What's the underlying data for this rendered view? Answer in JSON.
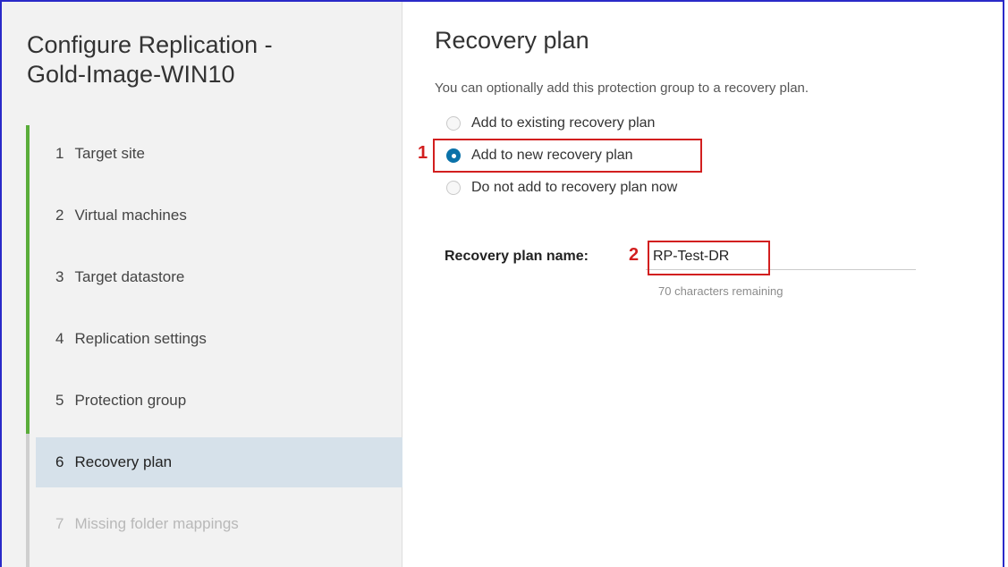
{
  "wizard": {
    "title_line1": "Configure Replication -",
    "title_line2": "Gold-Image-WIN10"
  },
  "steps": [
    {
      "number": "1",
      "label": "Target site",
      "state": "complete"
    },
    {
      "number": "2",
      "label": "Virtual machines",
      "state": "complete"
    },
    {
      "number": "3",
      "label": "Target datastore",
      "state": "complete"
    },
    {
      "number": "4",
      "label": "Replication settings",
      "state": "complete"
    },
    {
      "number": "5",
      "label": "Protection group",
      "state": "complete"
    },
    {
      "number": "6",
      "label": "Recovery plan",
      "state": "active"
    },
    {
      "number": "7",
      "label": "Missing folder mappings",
      "state": "disabled"
    }
  ],
  "page": {
    "title": "Recovery plan",
    "subtitle": "You can optionally add this protection group to a recovery plan."
  },
  "options": [
    {
      "label": "Add to existing recovery plan",
      "selected": false
    },
    {
      "label": "Add to new recovery plan",
      "selected": true
    },
    {
      "label": "Do not add to recovery plan now",
      "selected": false
    }
  ],
  "recovery_plan_name": {
    "label": "Recovery plan name:",
    "value": "RP-Test-DR",
    "helper": "70 characters remaining"
  },
  "callouts": [
    "1",
    "2"
  ],
  "colors": {
    "accent": "#0b72a9",
    "progress": "#5aad3a",
    "callout": "#d21f1f",
    "frame": "#2a2ac8"
  }
}
